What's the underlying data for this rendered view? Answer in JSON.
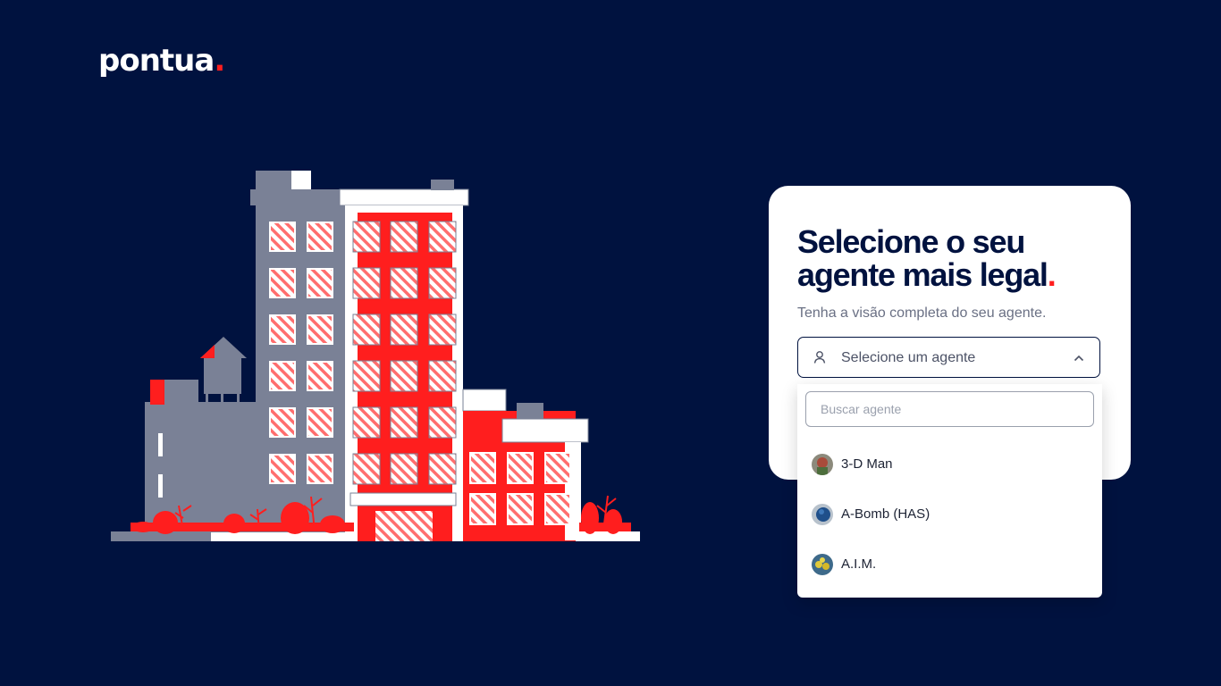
{
  "brand": {
    "logo_text": "pontua",
    "logo_dot": "."
  },
  "colors": {
    "background": "#00123f",
    "accent": "#ff1e1e",
    "card": "#ffffff"
  },
  "illustration": {
    "name": "city-buildings-illustration"
  },
  "card": {
    "title": "Selecione o seu agente mais legal",
    "title_dot": ".",
    "subtitle": "Tenha a visão completa do seu agente.",
    "select": {
      "placeholder": "Selecione um agente",
      "icon": "user-icon",
      "chevron": "chevron-up-icon"
    }
  },
  "dropdown": {
    "search_placeholder": "Buscar agente",
    "options": [
      {
        "label": "3-D Man",
        "avatar": "avatar-3d-man"
      },
      {
        "label": "A-Bomb (HAS)",
        "avatar": "avatar-a-bomb"
      },
      {
        "label": "A.I.M.",
        "avatar": "avatar-aim"
      }
    ]
  }
}
